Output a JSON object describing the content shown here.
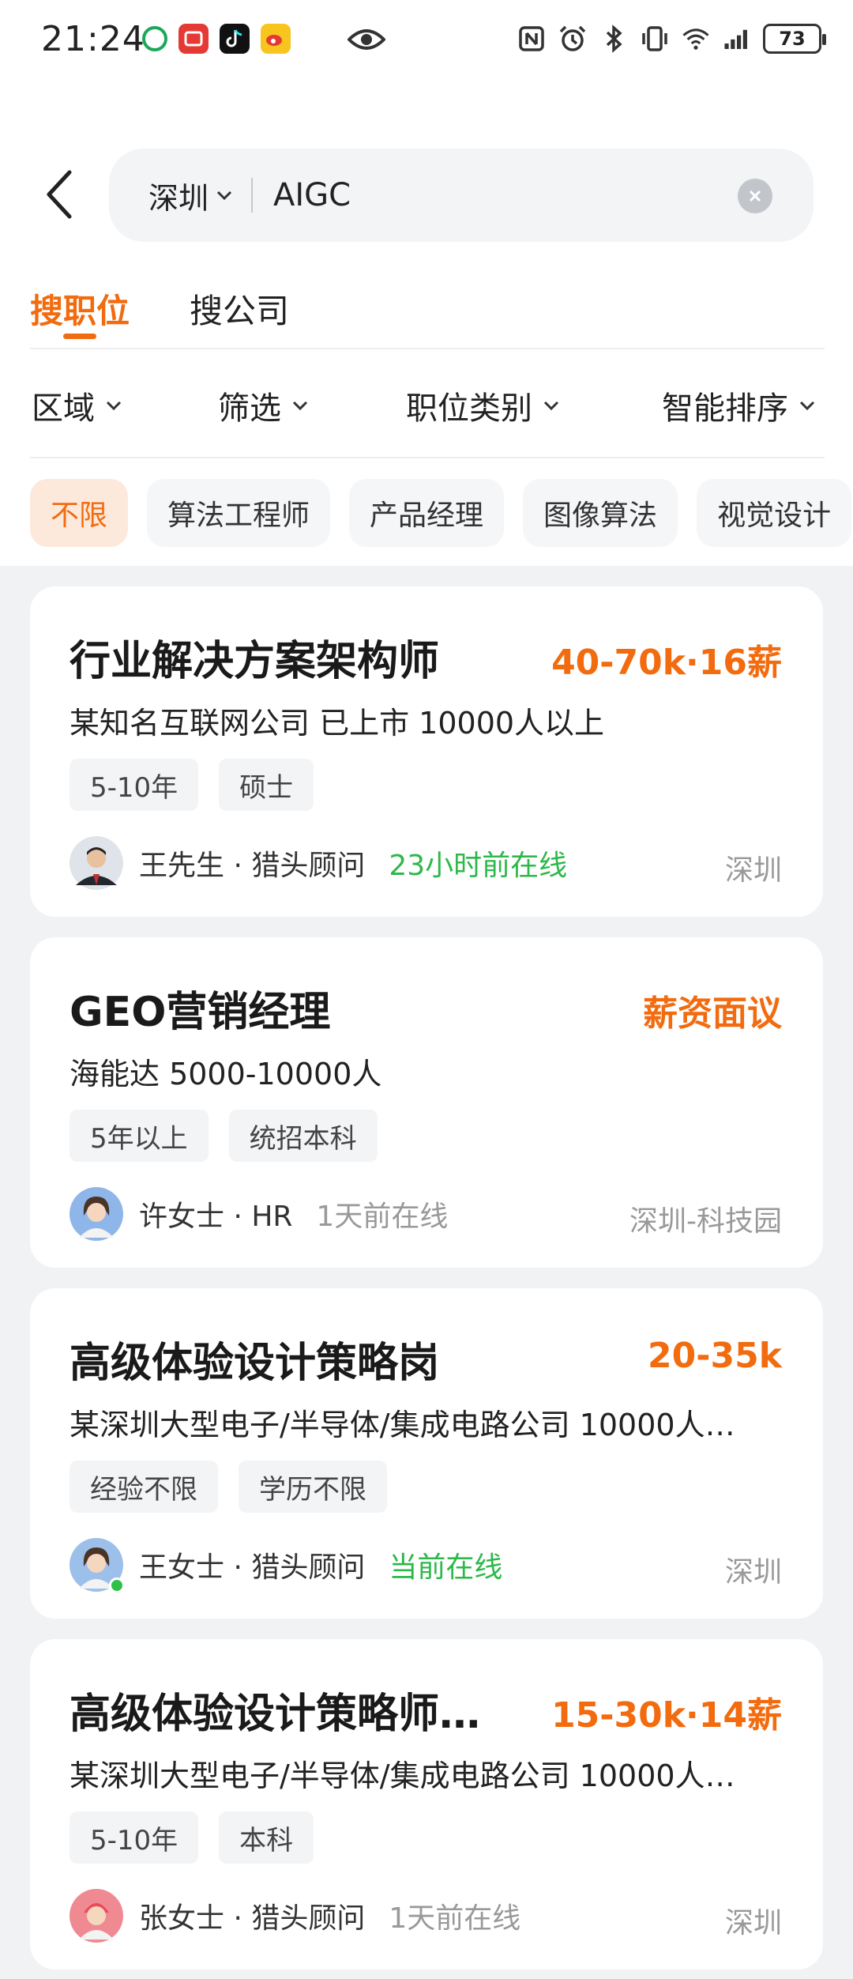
{
  "status_bar": {
    "time": "21:24",
    "battery": "73",
    "notification_icons": [
      "china-mobile-icon",
      "red-app-icon",
      "tiktok-icon",
      "weibo-icon"
    ],
    "system_icons": [
      "nfc-icon",
      "alarm-icon",
      "bluetooth-icon",
      "vibrate-icon",
      "wifi-icon",
      "signal-icon"
    ]
  },
  "search": {
    "city": "深圳",
    "query": "AIGC"
  },
  "tabs": [
    {
      "label": "搜职位",
      "active": true
    },
    {
      "label": "搜公司",
      "active": false
    }
  ],
  "filters": [
    "区域",
    "筛选",
    "职位类别",
    "智能排序"
  ],
  "chips": [
    {
      "label": "不限",
      "active": true
    },
    {
      "label": "算法工程师",
      "active": false
    },
    {
      "label": "产品经理",
      "active": false
    },
    {
      "label": "图像算法",
      "active": false
    },
    {
      "label": "视觉设计",
      "active": false
    }
  ],
  "jobs": [
    {
      "title": "行业解决方案架构师",
      "salary": "40-70k·16薪",
      "company": "某知名互联网公司  已上市  10000人以上",
      "tags": [
        "5-10年",
        "硕士"
      ],
      "recruiter": "王先生 · 猎头顾问",
      "status": "23小时前在线",
      "location": "深圳"
    },
    {
      "title": "GEO营销经理",
      "salary": "薪资面议",
      "company": "海能达  5000-10000人",
      "tags": [
        "5年以上",
        "统招本科"
      ],
      "recruiter": "许女士 · HR",
      "status": "1天前在线",
      "location": "深圳-科技园"
    },
    {
      "title": "高级体验设计策略岗",
      "salary": "20-35k",
      "company": "某深圳大型电子/半导体/集成电路公司  10000人…",
      "tags": [
        "经验不限",
        "学历不限"
      ],
      "recruiter": "王女士 · 猎头顾问",
      "status": "当前在线",
      "location": "深圳"
    },
    {
      "title": "高级体验设计策略师…",
      "salary": "15-30k·14薪",
      "company": "某深圳大型电子/半导体/集成电路公司  10000人…",
      "tags": [
        "5-10年",
        "本科"
      ],
      "recruiter": "张女士 · 猎头顾问",
      "status": "1天前在线",
      "location": "深圳"
    }
  ],
  "colors": {
    "accent": "#f26b0f",
    "online": "#2db84a",
    "background": "#f1f2f4"
  }
}
